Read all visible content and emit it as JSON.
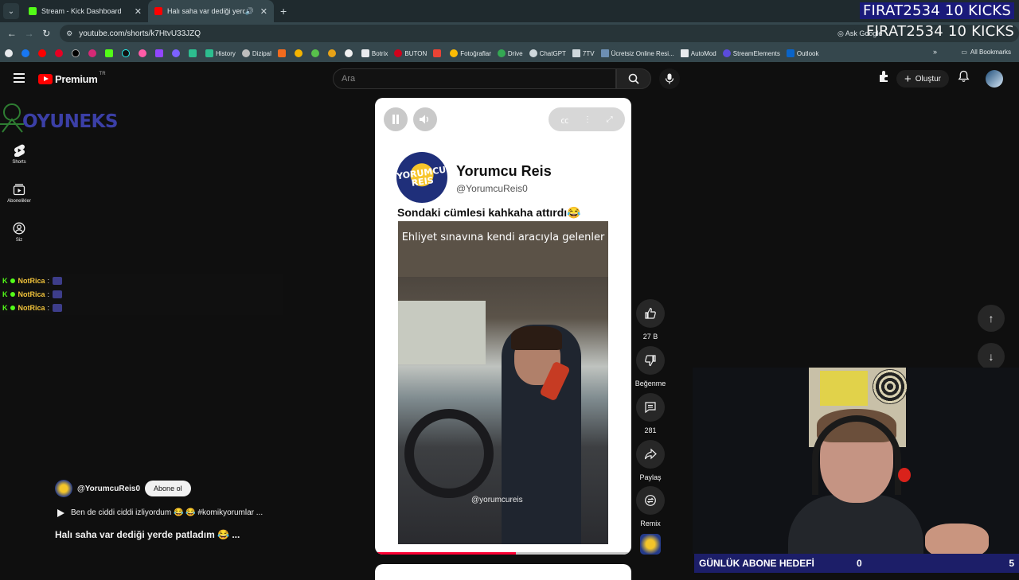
{
  "browser": {
    "tabs": [
      {
        "title": "Stream - Kick Dashboard",
        "favicon_color": "#53fc18"
      },
      {
        "title": "Halı saha var dediği yerde p",
        "favicon_color": "#ff0000"
      }
    ],
    "url": "youtube.com/shorts/k7HtvU33JZQ",
    "ask_google": "Ask Google",
    "bookmarks": [
      "History",
      "Dizipal",
      "Botrix",
      "BUTON",
      "Fotoğraflar",
      "Drive",
      "ChatGPT",
      "7TV",
      "Ücretsiz Online Resi...",
      "AutoMod",
      "StreamElements",
      "Outlook"
    ],
    "all_bookmarks": "All Bookmarks"
  },
  "overlay": {
    "alert_line1": "FIRAT2534  10 KICKS",
    "alert_line2": "FIRAT2534  10 KICKS",
    "brand": "OYUNEKS",
    "chat": [
      {
        "name": "NotRica",
        "sep": ":"
      },
      {
        "name": "NotRica",
        "sep": ":"
      },
      {
        "name": "NotRica",
        "sep": ":"
      }
    ],
    "goal": {
      "label": "GÜNLÜK ABONE HEDEFİ",
      "current": "0",
      "target": "5"
    }
  },
  "youtube": {
    "brand": "Premium",
    "region": "TR",
    "search_placeholder": "Ara",
    "create_label": "Oluştur",
    "rail": [
      {
        "label": "Shorts"
      },
      {
        "label": "Abonelikler"
      },
      {
        "label": "Siz"
      }
    ],
    "short": {
      "channel_name": "Yorumcu Reis",
      "channel_handle": "@YorumcuReis0",
      "logo_text": "YORUMCU REIS",
      "caption": "Sondaki cümlesi kahkaha attırdı😂",
      "overlay_text": "Ehliyet sınavına kendi aracıyla gelenler",
      "watermark": "@yorumcureis",
      "progress": 0.55
    },
    "actions": [
      {
        "label": "27 B",
        "icon": "like-icon"
      },
      {
        "label": "Beğenme",
        "icon": "dislike-icon"
      },
      {
        "label": "281",
        "icon": "comment-icon"
      },
      {
        "label": "Paylaş",
        "icon": "share-icon"
      },
      {
        "label": "Remix",
        "icon": "remix-icon"
      }
    ],
    "meta": {
      "handle": "@YorumcuReis0",
      "subscribe": "Abone ol",
      "description": "Ben de ciddi ciddi izliyordum 😂 😂 #komikyorumlar ...",
      "title": "Halı saha var dediği yerde patladım 😂 ..."
    }
  }
}
